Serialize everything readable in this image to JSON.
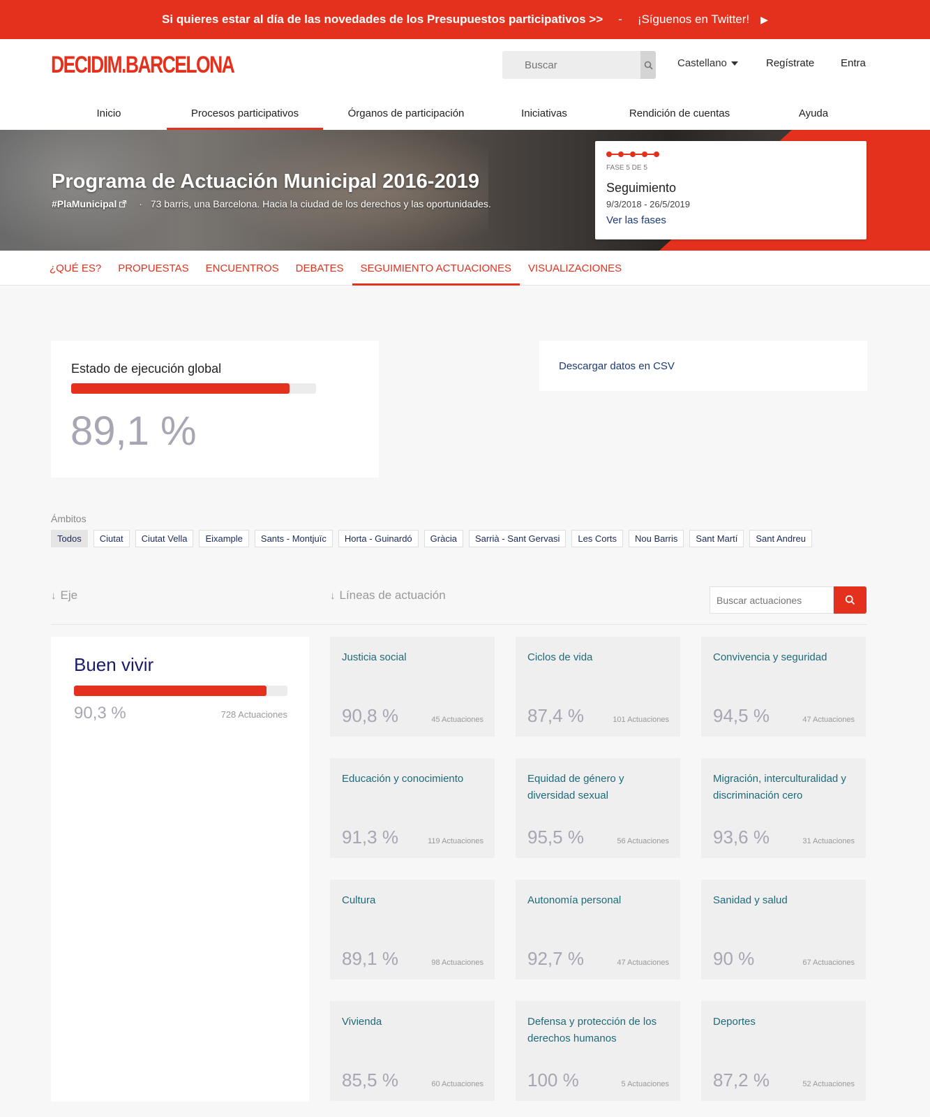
{
  "banner": {
    "text": "Si quieres estar al día de las novedades de los Presupuestos participativos >>",
    "separator": "-",
    "twitter": "¡Síguenos en Twitter!",
    "play_glyph": "▶"
  },
  "header": {
    "logo": "DECIDIM.BARCELONA",
    "search_placeholder": "Buscar",
    "language": "Castellano",
    "register": "Regístrate",
    "login": "Entra"
  },
  "main_nav": [
    {
      "label": "Inicio",
      "active": false
    },
    {
      "label": "Procesos participativos",
      "active": true
    },
    {
      "label": "Órganos de participación",
      "active": false
    },
    {
      "label": "Iniciativas",
      "active": false
    },
    {
      "label": "Rendición de cuentas",
      "active": false
    },
    {
      "label": "Ayuda",
      "active": false
    }
  ],
  "hero": {
    "title": "Programa de Actuación Municipal 2016-2019",
    "hashtag": "#PlaMunicipal",
    "bullet": "·",
    "subtitle": "73 barris, una Barcelona. Hacia la ciudad de los derechos y las oportunidades."
  },
  "phase": {
    "label": "FASE 5 DE 5",
    "title": "Seguimiento",
    "dates": "9/3/2018 - 26/5/2019",
    "link": "Ver las fases",
    "completed_steps": 5,
    "total_steps": 5
  },
  "sub_nav": [
    {
      "label": "¿Qué es?",
      "active": false
    },
    {
      "label": "Propuestas",
      "active": false
    },
    {
      "label": "Encuentros",
      "active": false
    },
    {
      "label": "Debates",
      "active": false
    },
    {
      "label": "Seguimiento actuaciones",
      "active": true
    },
    {
      "label": "Visualizaciones",
      "active": false
    }
  ],
  "global": {
    "title": "Estado de ejecución global",
    "value": "89,1 %",
    "progress": 0.891
  },
  "csv": {
    "label": "Descargar datos en CSV"
  },
  "ambitos": {
    "label": "Ámbitos",
    "filters": [
      "Todos",
      "Ciutat",
      "Ciutat Vella",
      "Eixample",
      "Sants - Montjuïc",
      "Horta - Guinardó",
      "Gràcia",
      "Sarrià - Sant Gervasi",
      "Les Corts",
      "Nou Barris",
      "Sant Martí",
      "Sant Andreu"
    ],
    "active": "Todos"
  },
  "columns": {
    "arrow": "↓",
    "eje": "Eje",
    "lineas": "Líneas de actuación",
    "search_placeholder": "Buscar actuaciones"
  },
  "eje": {
    "title": "Buen vivir",
    "value": "90,3 %",
    "count": "728 Actuaciones",
    "progress": 0.903
  },
  "lines": [
    {
      "title": "Justicia social",
      "value": "90,8 %",
      "count": "45 Actuaciones"
    },
    {
      "title": "Ciclos de vida",
      "value": "87,4 %",
      "count": "101 Actuaciones"
    },
    {
      "title": "Convivencia y seguridad",
      "value": "94,5 %",
      "count": "47 Actuaciones"
    },
    {
      "title": "Educación y conocimiento",
      "value": "91,3 %",
      "count": "119 Actuaciones"
    },
    {
      "title": "Equidad de género y diversidad sexual",
      "value": "95,5 %",
      "count": "56 Actuaciones"
    },
    {
      "title": "Migración, interculturalidad y discriminación cero",
      "value": "93,6 %",
      "count": "31 Actuaciones"
    },
    {
      "title": "Cultura",
      "value": "89,1 %",
      "count": "98 Actuaciones"
    },
    {
      "title": "Autonomía personal",
      "value": "92,7 %",
      "count": "47 Actuaciones"
    },
    {
      "title": "Sanidad y salud",
      "value": "90 %",
      "count": "67 Actuaciones"
    },
    {
      "title": "Vivienda",
      "value": "85,5 %",
      "count": "60 Actuaciones"
    },
    {
      "title": "Defensa y protección de los derechos humanos",
      "value": "100 %",
      "count": "5 Actuaciones"
    },
    {
      "title": "Deportes",
      "value": "87,2 %",
      "count": "52 Actuaciones"
    }
  ],
  "colors": {
    "accent": "#e3311d",
    "link": "#1a3a7a",
    "teal": "#1f6a78",
    "muted_value": "#a8a6b3"
  },
  "icons": {
    "search": "search-icon",
    "external": "external-link-icon",
    "arrow_down": "arrow-down-icon",
    "caret": "caret-down-icon",
    "play": "play-icon"
  }
}
